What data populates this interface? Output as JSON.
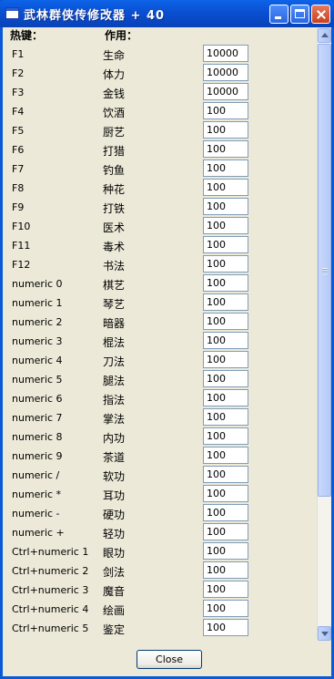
{
  "window": {
    "title": "武林群侠传修改器 + 40"
  },
  "headers": {
    "hotkey": "热键：",
    "function": "作用："
  },
  "rows": [
    {
      "hotkey": "F1",
      "function": "生命",
      "value": "10000"
    },
    {
      "hotkey": "F2",
      "function": "体力",
      "value": "10000"
    },
    {
      "hotkey": "F3",
      "function": "金钱",
      "value": "10000"
    },
    {
      "hotkey": "F4",
      "function": "饮酒",
      "value": "100"
    },
    {
      "hotkey": "F5",
      "function": "厨艺",
      "value": "100"
    },
    {
      "hotkey": "F6",
      "function": "打猎",
      "value": "100"
    },
    {
      "hotkey": "F7",
      "function": "钓鱼",
      "value": "100"
    },
    {
      "hotkey": "F8",
      "function": "种花",
      "value": "100"
    },
    {
      "hotkey": "F9",
      "function": "打铁",
      "value": "100"
    },
    {
      "hotkey": "F10",
      "function": "医术",
      "value": "100"
    },
    {
      "hotkey": "F11",
      "function": "毒术",
      "value": "100"
    },
    {
      "hotkey": "F12",
      "function": "书法",
      "value": "100"
    },
    {
      "hotkey": "numeric 0",
      "function": "棋艺",
      "value": "100"
    },
    {
      "hotkey": "numeric 1",
      "function": "琴艺",
      "value": "100"
    },
    {
      "hotkey": "numeric 2",
      "function": "暗器",
      "value": "100"
    },
    {
      "hotkey": "numeric 3",
      "function": "棍法",
      "value": "100"
    },
    {
      "hotkey": "numeric 4",
      "function": "刀法",
      "value": "100"
    },
    {
      "hotkey": "numeric 5",
      "function": "腿法",
      "value": "100"
    },
    {
      "hotkey": "numeric 6",
      "function": "指法",
      "value": "100"
    },
    {
      "hotkey": "numeric 7",
      "function": "掌法",
      "value": "100"
    },
    {
      "hotkey": "numeric 8",
      "function": "内功",
      "value": "100"
    },
    {
      "hotkey": "numeric 9",
      "function": "茶道",
      "value": "100"
    },
    {
      "hotkey": "numeric /",
      "function": "软功",
      "value": "100"
    },
    {
      "hotkey": "numeric *",
      "function": "耳功",
      "value": "100"
    },
    {
      "hotkey": "numeric -",
      "function": "硬功",
      "value": "100"
    },
    {
      "hotkey": "numeric +",
      "function": "轻功",
      "value": "100"
    },
    {
      "hotkey": "Ctrl+numeric 1",
      "function": "眼功",
      "value": "100"
    },
    {
      "hotkey": "Ctrl+numeric 2",
      "function": "剑法",
      "value": "100"
    },
    {
      "hotkey": "Ctrl+numeric 3",
      "function": "魔音",
      "value": "100"
    },
    {
      "hotkey": "Ctrl+numeric 4",
      "function": "绘画",
      "value": "100"
    },
    {
      "hotkey": "Ctrl+numeric 5",
      "function": "鉴定",
      "value": "100"
    }
  ],
  "footer": {
    "close_label": "Close"
  }
}
